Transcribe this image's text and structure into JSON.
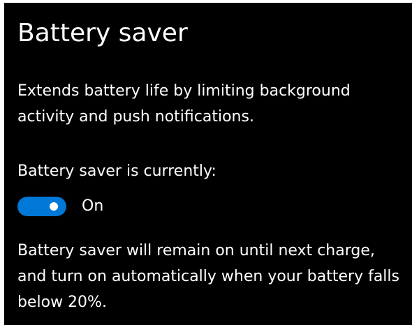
{
  "settings": {
    "title": "Battery saver",
    "description": "Extends battery life by limiting background activity and push notifications.",
    "status_label": "Battery saver is currently:",
    "toggle": {
      "state": "On",
      "enabled": true,
      "accent_color": "#0078d7"
    },
    "footer": "Battery saver will remain on until next charge, and turn on automatically when your battery falls below 20%."
  }
}
